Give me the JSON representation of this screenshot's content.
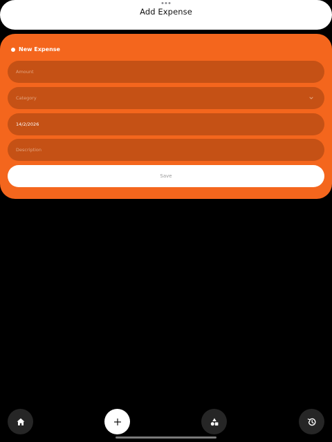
{
  "header": {
    "title": "Add Expense"
  },
  "form": {
    "title": "New Expense",
    "amount_placeholder": "Amount",
    "category_placeholder": "Category",
    "date_value": "14/2/2026",
    "description_placeholder": "Description",
    "save_label": "Save"
  },
  "nav": {
    "items": [
      {
        "icon": "home-icon"
      },
      {
        "icon": "plus-icon"
      },
      {
        "icon": "shapes-icon"
      },
      {
        "icon": "history-icon"
      }
    ]
  },
  "colors": {
    "accent": "#f4661d",
    "field_bg": "#c55115",
    "background": "#000000",
    "nav_button": "#262626"
  }
}
